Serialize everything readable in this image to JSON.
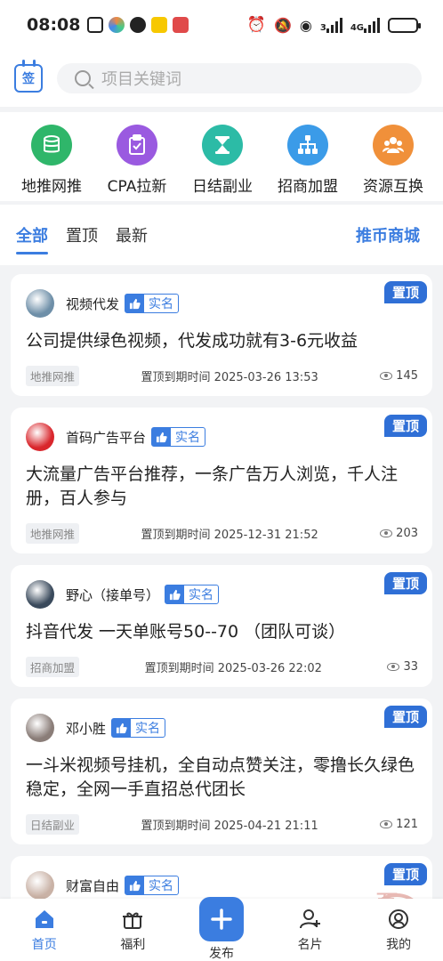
{
  "status": {
    "time": "08:08",
    "network": "4G",
    "battery_pct": 0.8,
    "sim1_label": "3",
    "sim2_label": "4G"
  },
  "search": {
    "placeholder": "项目关键词",
    "calendar_char": "签"
  },
  "categories": [
    {
      "label": "地推网推",
      "color": "#2fb66a",
      "icon": "database-icon"
    },
    {
      "label": "CPA拉新",
      "color": "#9a5ae0",
      "icon": "clipboard-check-icon"
    },
    {
      "label": "日结副业",
      "color": "#2cbba6",
      "icon": "hourglass-icon"
    },
    {
      "label": "招商加盟",
      "color": "#3b9be8",
      "icon": "org-chart-icon"
    },
    {
      "label": "资源互换",
      "color": "#f0903a",
      "icon": "people-icon"
    }
  ],
  "tabs": {
    "all": "全部",
    "pinned": "置顶",
    "latest": "最新",
    "mall": "推币商城"
  },
  "posts": [
    {
      "poster": "视频代发",
      "verified": "实名",
      "title": "公司提供绿色视频，代发成功就有3-6元收益",
      "category": "地推网推",
      "expire": "置顶到期时间 2025-03-26 13:53",
      "views": "145",
      "pin": "置顶",
      "avatar_color": "#6e8fa8"
    },
    {
      "poster": "首码广告平台",
      "verified": "实名",
      "title": "大流量广告平台推荐，一条广告万人浏览，千人注册，百人参与",
      "category": "地推网推",
      "expire": "置顶到期时间 2025-12-31 21:52",
      "views": "203",
      "pin": "置顶",
      "avatar_color": "#d9262c"
    },
    {
      "poster": "野心（接单号）",
      "verified": "实名",
      "title": "抖音代发 一天单账号50--70 （团队可谈）",
      "category": "招商加盟",
      "expire": "置顶到期时间 2025-03-26 22:02",
      "views": "33",
      "pin": "置顶",
      "avatar_color": "#3a4a5c"
    },
    {
      "poster": "邓小胜",
      "verified": "实名",
      "title": "一斗米视频号挂机，全自动点赞关注，零撸长久绿色稳定，全网一手直招总代团长",
      "category": "日结副业",
      "expire": "置顶到期时间 2025-04-21 21:11",
      "views": "121",
      "pin": "置顶",
      "avatar_color": "#8a7d78"
    },
    {
      "poster": "财富自由",
      "verified": "实名",
      "pin": "置顶",
      "avatar_color": "#c9b2a6"
    }
  ],
  "nav": {
    "home": "首页",
    "welfare": "福利",
    "publish": "发布",
    "card": "名片",
    "mine": "我的"
  },
  "watermark": {
    "text": "吾爱首码"
  },
  "colors": {
    "accent": "#3b7de0",
    "pin_badge": "#2f6fd6"
  }
}
